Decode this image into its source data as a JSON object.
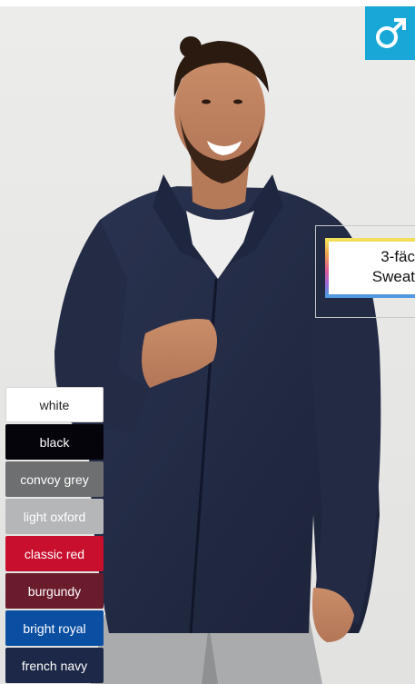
{
  "product_image": {
    "alt": "man wearing a french navy full-zip sweat jacket"
  },
  "gender_badge": {
    "icon": "male-symbol-icon",
    "color": "#18a7d6"
  },
  "callout": {
    "lines": [
      "3-fäc",
      "Sweat"
    ]
  },
  "swatches": [
    {
      "label": "white",
      "color": "#ffffff"
    },
    {
      "label": "black",
      "color": "#05040a"
    },
    {
      "label": "convoy grey",
      "color": "#6d6f70"
    },
    {
      "label": "light oxford",
      "color": "#b5b6b8"
    },
    {
      "label": "classic red",
      "color": "#c8102e"
    },
    {
      "label": "burgundy",
      "color": "#6a1c2c"
    },
    {
      "label": "bright royal",
      "color": "#0b4fa3"
    },
    {
      "label": "french navy",
      "color": "#1d2747"
    }
  ]
}
